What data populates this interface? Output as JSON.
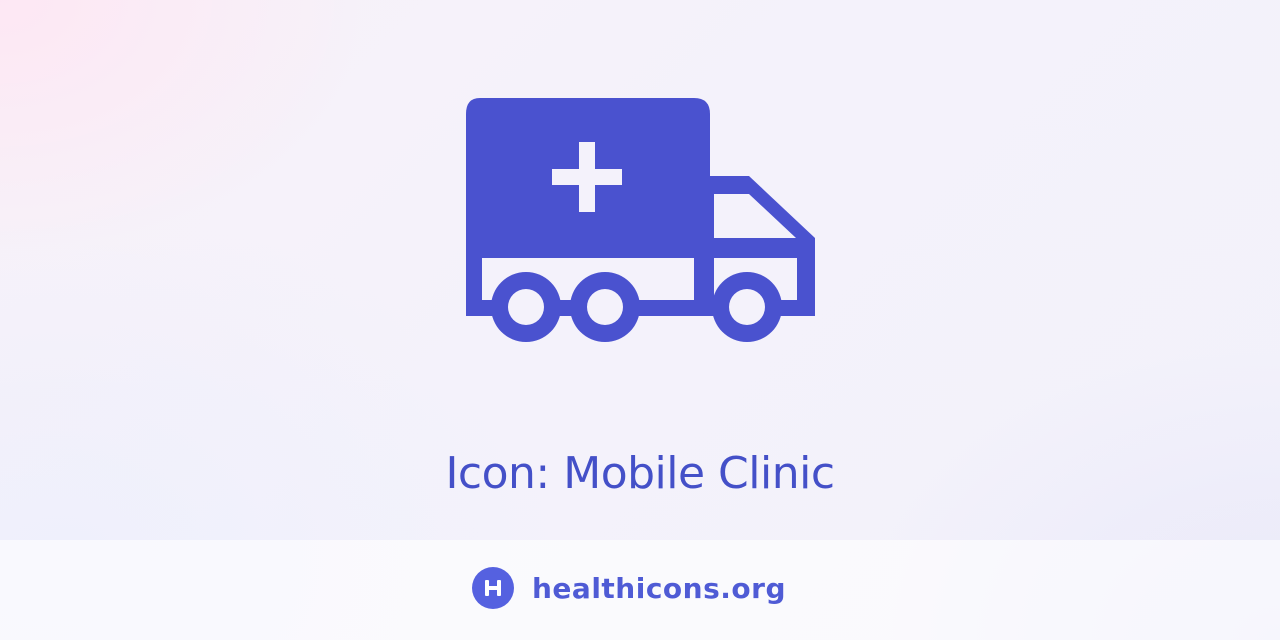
{
  "icon": {
    "name": "mobile-clinic-truck-icon",
    "color": "#4a52cf"
  },
  "caption": {
    "text": "Icon: Mobile Clinic"
  },
  "footer": {
    "logo_icon": "healthicons-h-logo-icon",
    "site": "healthicons.org",
    "logo_color": "#5561e0",
    "text_color": "#4f5bd5"
  }
}
